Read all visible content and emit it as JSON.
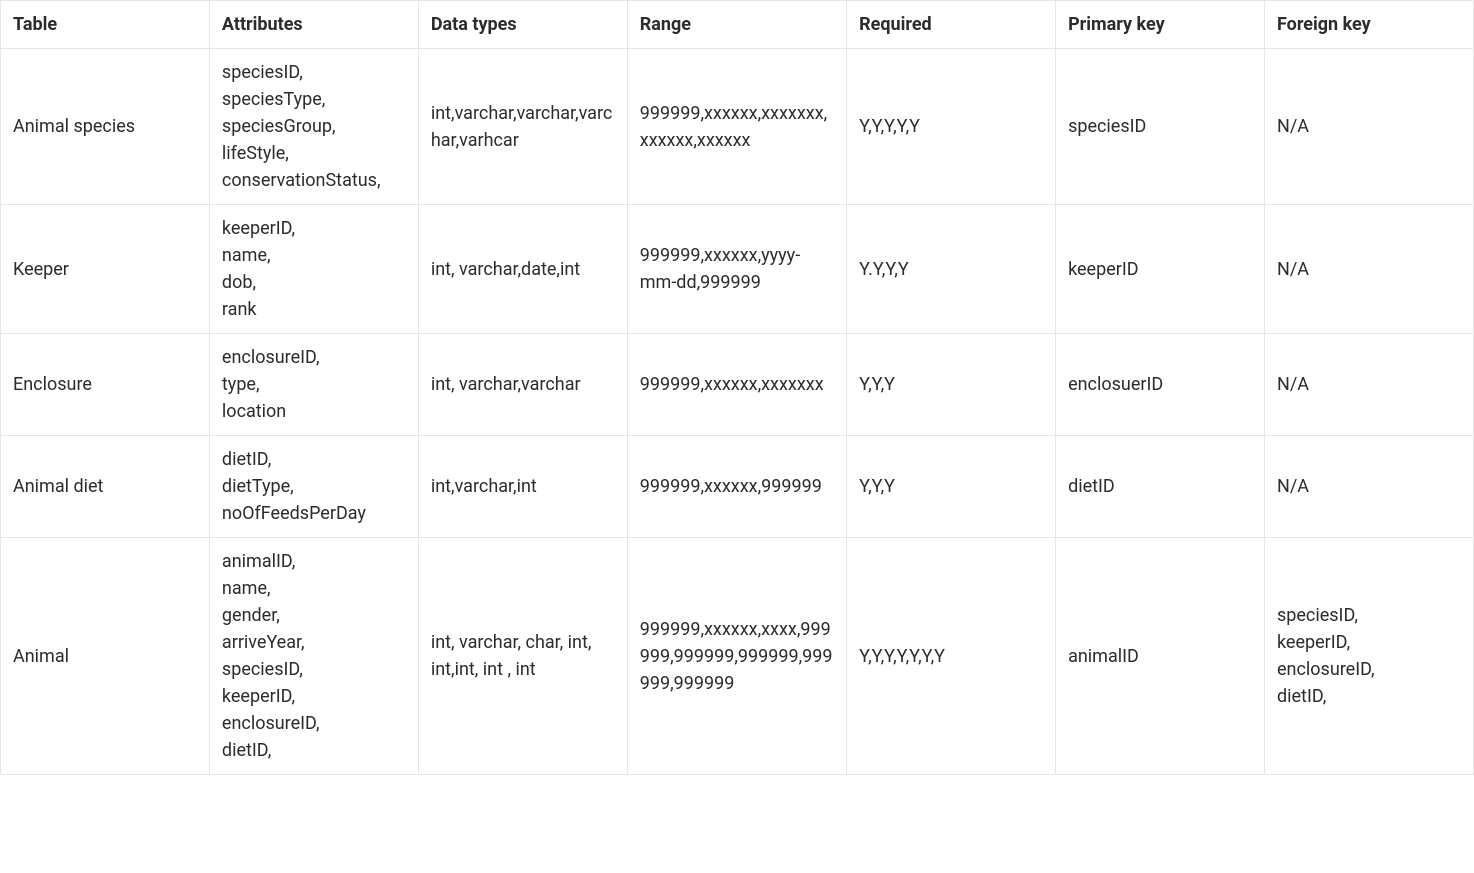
{
  "headers": {
    "col0": "Table",
    "col1": "Attributes",
    "col2": "Data types",
    "col3": "Range",
    "col4": "Required",
    "col5": "Primary key",
    "col6": "Foreign key"
  },
  "rows": [
    {
      "table": "Animal species",
      "attributes": [
        "speciesID,",
        "speciesType,",
        "speciesGroup,",
        "lifeStyle,",
        "conservationStatus,"
      ],
      "dataTypes": "int,varchar,varchar,varchar,varhcar",
      "range": "999999,xxxxxx,xxxxxxx,xxxxxx,xxxxxx",
      "required": "Y,Y,Y,Y,Y",
      "primaryKey": "speciesID",
      "foreignKey": "N/A"
    },
    {
      "table": "Keeper",
      "attributes": [
        "keeperID,",
        "name,",
        "dob,",
        "rank"
      ],
      "dataTypes": "int, varchar,date,int",
      "range": "999999,xxxxxx,yyyy-mm-dd,999999",
      "required": "Y.Y,Y,Y",
      "primaryKey": "keeperID",
      "foreignKey": "N/A"
    },
    {
      "table": "Enclosure",
      "attributes": [
        "enclosureID,",
        "type,",
        "location"
      ],
      "dataTypes": "int, varchar,varchar",
      "range": "999999,xxxxxx,xxxxxxx",
      "required": "Y,Y,Y",
      "primaryKey": "enclosuerID",
      "foreignKey": "N/A"
    },
    {
      "table": "Animal diet",
      "attributes": [
        "dietID,",
        "dietType,",
        "noOfFeedsPerDay"
      ],
      "dataTypes": "int,varchar,int",
      "range": "999999,xxxxxx,999999",
      "required": "Y,Y,Y",
      "primaryKey": "dietID",
      "foreignKey": "N/A"
    },
    {
      "table": "Animal",
      "attributes": [
        "animalID,",
        "name,",
        "gender,",
        "arriveYear,",
        "speciesID,",
        "keeperID,",
        "enclosureID,",
        "dietID,"
      ],
      "dataTypes": "int, varchar, char, int, int,int, int , int",
      "range": "999999,xxxxxx,xxxx,999999,999999,999999,999999,999999",
      "required": "Y,Y,Y,Y,Y,Y,Y",
      "primaryKey": "animalID",
      "foreignKey": "speciesID,\nkeeperID,\nenclosureID,\ndietID,"
    }
  ]
}
